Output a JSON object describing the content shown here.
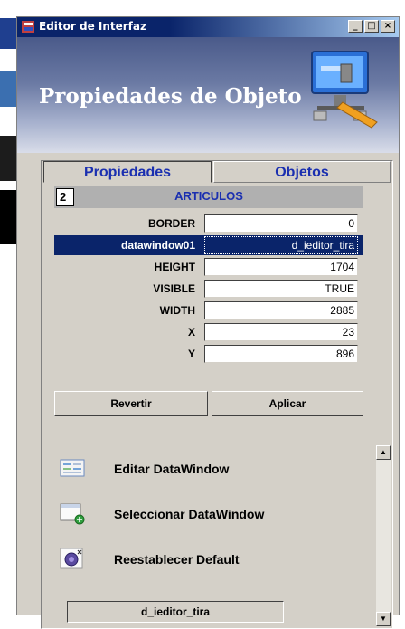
{
  "window": {
    "title": "Editor de Interfaz",
    "minimize_label": "_",
    "maximize_label": "□",
    "close_label": "×"
  },
  "header": {
    "title": "Propiedades de Objeto"
  },
  "tabs": [
    {
      "label": "Propiedades",
      "active": true
    },
    {
      "label": "Objetos",
      "active": false
    }
  ],
  "section": {
    "number": "2",
    "title": "ARTICULOS"
  },
  "properties": [
    {
      "label": "BORDER",
      "value": "0",
      "selected": false
    },
    {
      "label": "datawindow01",
      "value": "d_ieditor_tira",
      "selected": true
    },
    {
      "label": "HEIGHT",
      "value": "1704",
      "selected": false
    },
    {
      "label": "VISIBLE",
      "value": "TRUE",
      "selected": false
    },
    {
      "label": "WIDTH",
      "value": "2885",
      "selected": false
    },
    {
      "label": "X",
      "value": "23",
      "selected": false
    },
    {
      "label": "Y",
      "value": "896",
      "selected": false
    }
  ],
  "buttons": {
    "revert": "Revertir",
    "apply": "Aplicar"
  },
  "actions": [
    {
      "label": "Editar DataWindow",
      "icon": "datawindow-edit-icon"
    },
    {
      "label": "Seleccionar DataWindow",
      "icon": "datawindow-select-icon"
    },
    {
      "label": "Reestablecer Default",
      "icon": "reset-default-icon"
    }
  ],
  "status_value": "d_ieditor_tira",
  "colors": {
    "title_bar": "#0a246a",
    "tab_text": "#1a2fb0",
    "selection": "#0a246a",
    "face": "#d4d0c8"
  }
}
